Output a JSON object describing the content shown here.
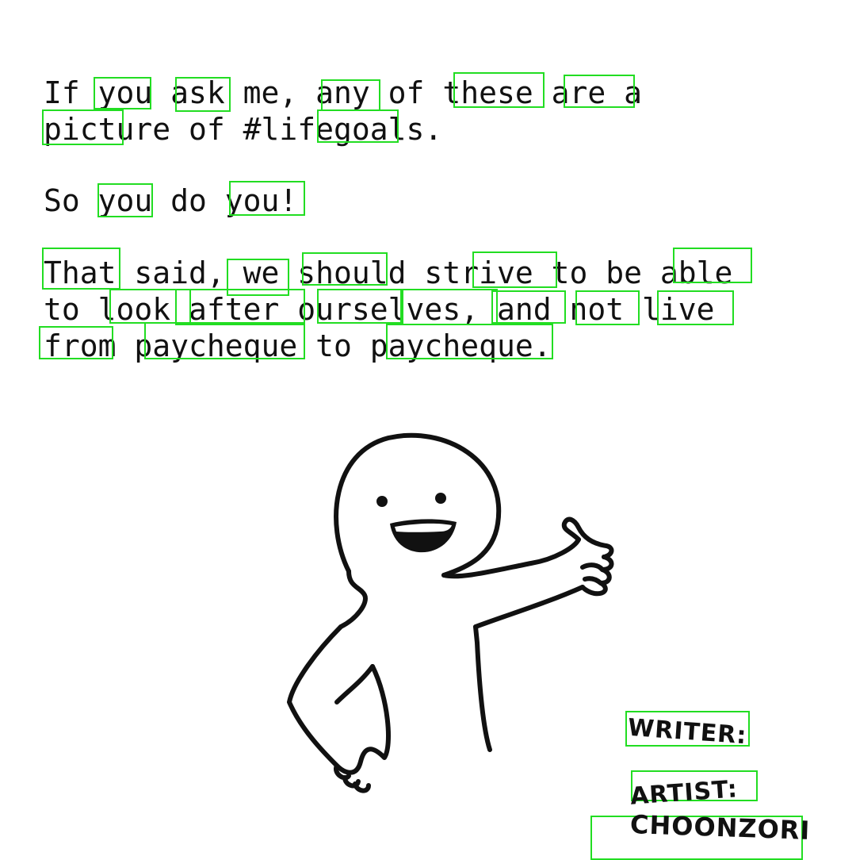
{
  "text": {
    "paragraph_1": "If you ask me, any of these are a\npicture of #lifegoals.",
    "paragraph_2": "So you do you!",
    "paragraph_3": "That said, we should strive to be able\nto look after ourselves, and not live\nfrom paycheque to paycheque."
  },
  "credits": {
    "writer_label": "WRITER:",
    "artist_label": "ARTIST:",
    "artist_name": "CHOONZORI"
  },
  "colors": {
    "highlight_box": "#22dd22",
    "ink": "#111111",
    "background": "#ffffff"
  },
  "figure": {
    "description_icon": "thumbs-up-stick-figure"
  }
}
